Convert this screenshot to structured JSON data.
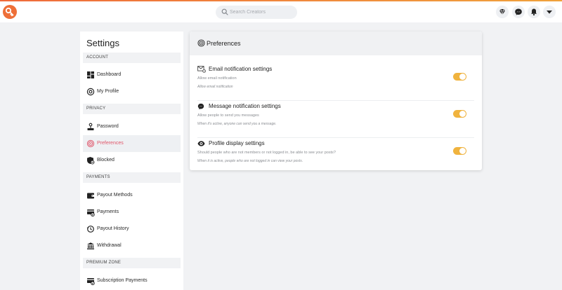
{
  "brand": {
    "accent": "#ee6f38",
    "toggle_on": "#f0b33e",
    "active_text": "#e0566a"
  },
  "topbar": {
    "logo_icon": "key-logo-icon",
    "search": {
      "placeholder": "Search Creators"
    },
    "icons": [
      "diamond-icon",
      "messenger-icon",
      "bell-icon",
      "chevron-down-icon"
    ]
  },
  "sidebar": {
    "title": "Settings",
    "sections": {
      "account": "ACCOUNT",
      "privacy": "PRIVACY",
      "payments": "PAYMENTS",
      "premium": "PREMIUM ZONE"
    },
    "items": {
      "dashboard": "Dashboard",
      "profile": "My Profile",
      "password": "Password",
      "preferences": "Preferences",
      "blocked": "Blocked",
      "payout_methods": "Payout Methods",
      "payments": "Payments",
      "payout_history": "Payout History",
      "withdrawal": "Withdrawal",
      "subscription_payments": "Subscription Payments"
    },
    "active_item": "Preferences"
  },
  "panel": {
    "title": "Preferences",
    "settings": [
      {
        "title": "Email notification settings",
        "description": "Allow email notification",
        "note": "Allow email notification",
        "enabled": true
      },
      {
        "title": "Message notification settings",
        "description": "Allow people to send you messages",
        "note": "When it's active, anyone can send you a message.",
        "enabled": true
      },
      {
        "title": "Profile display settings",
        "description": "Should people who are not members or not logged in, be able to see your posts?",
        "note": "When it is active, people who are not logged in can view your posts.",
        "enabled": true
      }
    ]
  }
}
